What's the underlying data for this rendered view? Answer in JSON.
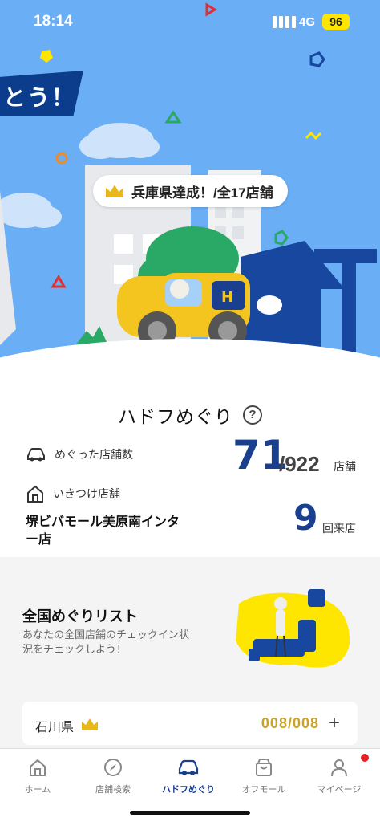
{
  "status_bar": {
    "time": "18:14",
    "network": "4G",
    "battery": "96"
  },
  "hero": {
    "banner_text": "とう！",
    "achievement_text": "兵庫県達成！/全17店舗"
  },
  "main": {
    "title": "ハドフめぐり",
    "help_symbol": "?",
    "visited": {
      "label": "めぐった店舗数",
      "count": "71",
      "total": "/922",
      "unit": "店舗"
    },
    "favorite": {
      "label": "いきつけ店舗",
      "store_name": "堺ビバモール美原南インター店",
      "count": "9",
      "unit": "回来店"
    }
  },
  "list": {
    "title": "全国めぐりリスト",
    "description": "あなたの全国店舗のチェックイン状況をチェックしよう！",
    "prefectures": [
      {
        "name": "石川県",
        "count": "008/008",
        "expand": "+"
      }
    ]
  },
  "tabs": [
    {
      "label": "ホーム",
      "icon": "home-icon"
    },
    {
      "label": "店舗検索",
      "icon": "compass-icon"
    },
    {
      "label": "ハドフめぐり",
      "icon": "car-icon"
    },
    {
      "label": "オフモール",
      "icon": "bag-icon"
    },
    {
      "label": "マイページ",
      "icon": "user-icon"
    }
  ],
  "colors": {
    "sky": "#6aaef5",
    "navy": "#1a3f8f",
    "gold": "#c9a227",
    "yellow": "#ffe600"
  }
}
